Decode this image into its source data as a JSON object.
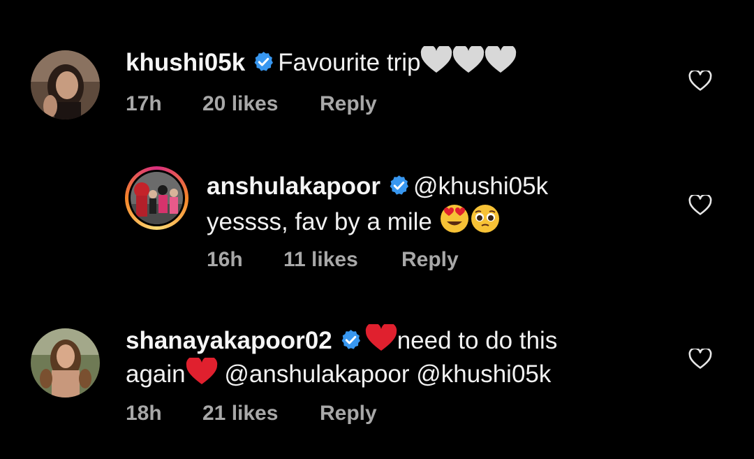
{
  "comments": [
    {
      "username": "khushi05k",
      "text_lines": [
        "Favourite trip"
      ],
      "time": "17h",
      "likes": "20 likes",
      "reply": "Reply",
      "avatar_icon": "profile-photo"
    },
    {
      "username": "anshulakapoor",
      "mention": "@khushi05k",
      "text_lines": [
        "yessss, fav by a mile"
      ],
      "time": "16h",
      "likes": "11 likes",
      "reply": "Reply",
      "avatar_icon": "profile-photo-story-ring"
    },
    {
      "username": "shanayakapoor02",
      "text_lines": [
        "need to do this",
        "again"
      ],
      "mentions": "@anshulakapoor @khushi05k",
      "time": "18h",
      "likes": "21 likes",
      "reply": "Reply",
      "avatar_icon": "profile-photo"
    }
  ],
  "icons": {
    "verified": "verified-badge-icon",
    "like": "heart-outline-icon",
    "white_heart": "white-heart-emoji",
    "red_heart": "red-heart-emoji",
    "heart_eyes": "heart-eyes-emoji",
    "pleading": "pleading-face-emoji"
  },
  "colors": {
    "background": "#000000",
    "text": "#f2f2f2",
    "meta": "#a8a8a8",
    "verified": "#3897f0",
    "red_heart": "#e0202e",
    "story_ring": "#d92e7f"
  }
}
